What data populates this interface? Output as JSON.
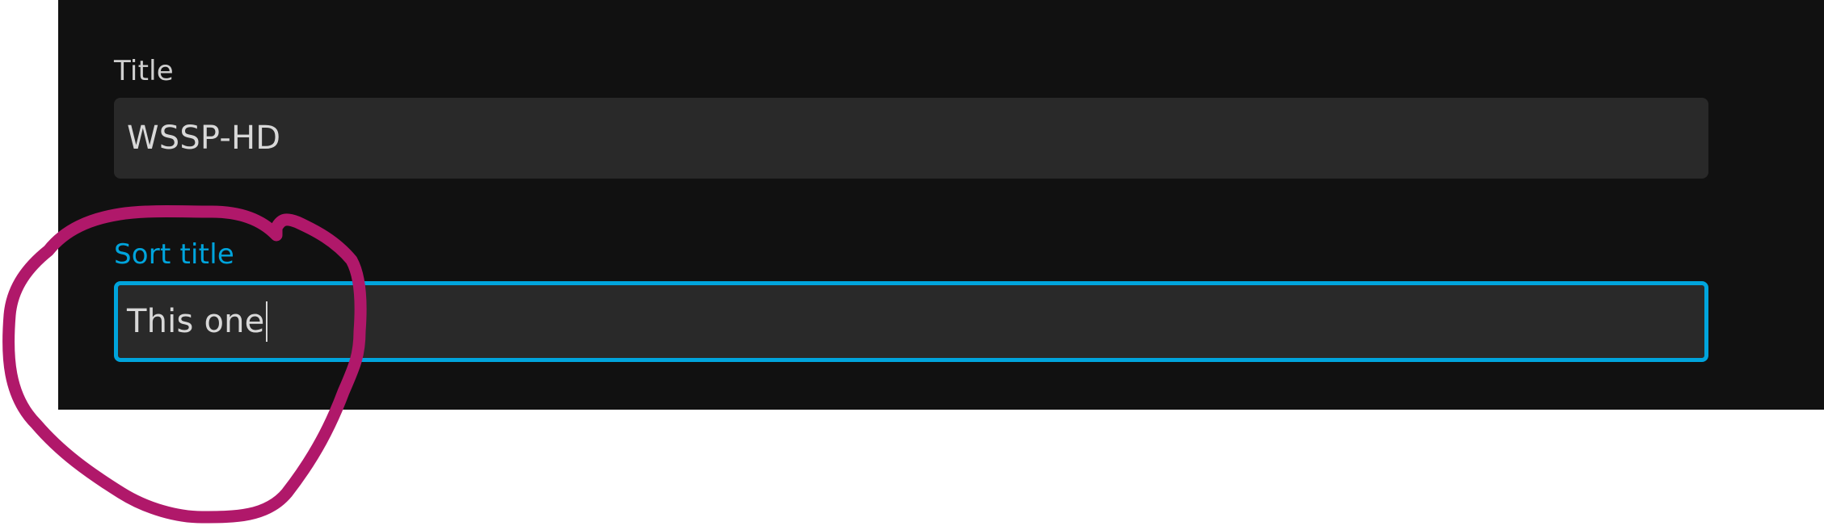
{
  "form": {
    "title_label": "Title",
    "title_value": "WSSP-HD",
    "sort_title_label": "Sort title",
    "sort_title_value": "This one"
  },
  "colors": {
    "panel_background": "#111111",
    "input_background": "#292929",
    "focus_accent": "#00a4dc",
    "annotation_stroke": "#b0186a"
  }
}
